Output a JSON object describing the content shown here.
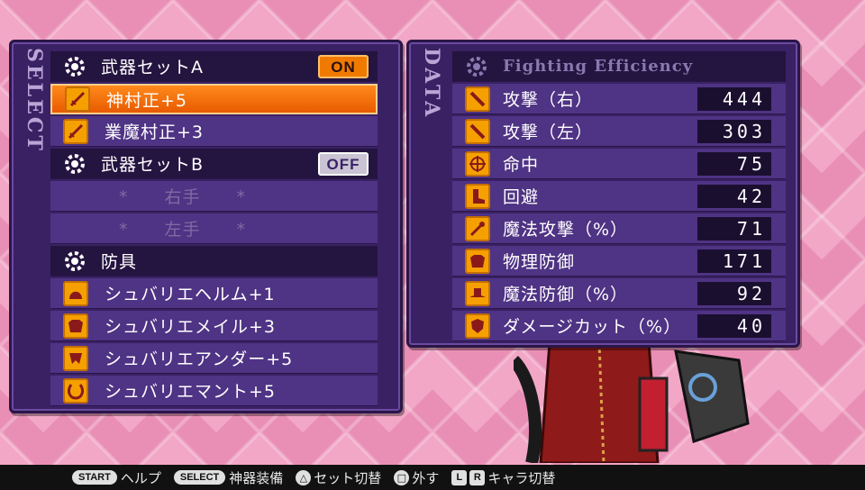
{
  "select_panel": {
    "side_label": "SELECT",
    "rows": [
      {
        "kind": "header",
        "label": "武器セットA",
        "toggle": "ON"
      },
      {
        "kind": "item",
        "label": "神村正+5"
      },
      {
        "kind": "item",
        "label": "業魔村正+3"
      },
      {
        "kind": "header",
        "label": "武器セットB",
        "toggle": "OFF"
      },
      {
        "kind": "empty",
        "label": "*　　右手　　*"
      },
      {
        "kind": "empty",
        "label": "*　　左手　　*"
      },
      {
        "kind": "header",
        "label": "防具"
      },
      {
        "kind": "item",
        "label": "シュバリエヘルム+1"
      },
      {
        "kind": "item",
        "label": "シュバリエメイル+3"
      },
      {
        "kind": "item",
        "label": "シュバリエアンダー+5"
      },
      {
        "kind": "item",
        "label": "シュバリエマント+5"
      }
    ]
  },
  "data_panel": {
    "side_label": "DATA",
    "title": "Fighting Efficiency",
    "stats": [
      {
        "label": "攻撃（右）",
        "value": "444"
      },
      {
        "label": "攻撃（左）",
        "value": "303"
      },
      {
        "label": "命中",
        "value": "75"
      },
      {
        "label": "回避",
        "value": "42"
      },
      {
        "label": "魔法攻撃（%）",
        "value": "71"
      },
      {
        "label": "物理防御",
        "value": "171"
      },
      {
        "label": "魔法防御（%）",
        "value": "92"
      },
      {
        "label": "ダメージカット（%）",
        "value": "40"
      }
    ]
  },
  "bottombar": {
    "start_btn": "START",
    "start_text": "ヘルプ",
    "select_btn": "SELECT",
    "select_text": "神器装備",
    "triangle_text": "セット切替",
    "square_text": "外す",
    "l_key": "L",
    "r_key": "R",
    "lr_text": "キャラ切替"
  },
  "colors": {
    "accent_orange": "#f07a00",
    "panel_purple": "#3a2164",
    "row_purple": "#4f3384"
  }
}
